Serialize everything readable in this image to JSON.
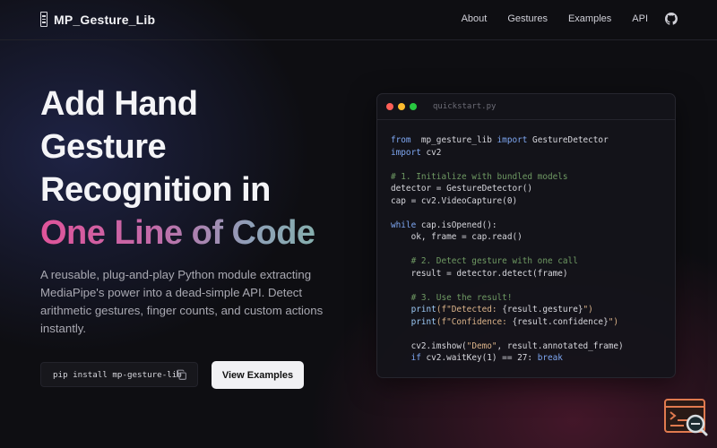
{
  "nav": {
    "brand": "MP_Gesture_Lib",
    "links": [
      "About",
      "Gestures",
      "Examples",
      "API"
    ],
    "github_icon": "github-icon"
  },
  "hero": {
    "title_lines": [
      "Add Hand",
      "Gesture",
      "Recognition in"
    ],
    "title_highlight": "One Line of Code",
    "description": "A reusable, plug-and-play Python module extracting MediaPipe's power into a dead-simple API. Detect arithmetic gestures, finger counts, and custom actions instantly.",
    "install_command": "pip install mp-gesture-lib",
    "copy_icon": "copy-icon",
    "cta_label": "View Examples"
  },
  "code_window": {
    "filename": "quickstart.py",
    "lines": [
      [
        [
          "kw",
          "from"
        ],
        [
          "",
          "  mp_gesture_lib "
        ],
        [
          "kw",
          "import"
        ],
        [
          "",
          " GestureDetector"
        ]
      ],
      [
        [
          "kw",
          "import"
        ],
        [
          "",
          " cv2"
        ]
      ],
      [
        [
          "",
          ""
        ]
      ],
      [
        [
          "cm",
          "# 1. Initialize with bundled models"
        ]
      ],
      [
        [
          "",
          "detector = GestureDetector()"
        ]
      ],
      [
        [
          "",
          "cap = cv2.VideoCapture(0)"
        ]
      ],
      [
        [
          "",
          ""
        ]
      ],
      [
        [
          "kw",
          "while"
        ],
        [
          "",
          " cap.isOpened():"
        ]
      ],
      [
        [
          "",
          "    ok, frame = cap.read()"
        ]
      ],
      [
        [
          "",
          ""
        ]
      ],
      [
        [
          "cm",
          "    # 2. Detect gesture with one call"
        ]
      ],
      [
        [
          "",
          "    result = detector.detect(frame)"
        ]
      ],
      [
        [
          "",
          ""
        ]
      ],
      [
        [
          "cm",
          "    # 3. Use the result!"
        ]
      ],
      [
        [
          "fx",
          "    print"
        ],
        [
          "st",
          "(f\"Detected: "
        ],
        [
          "",
          "{result.gesture}"
        ],
        [
          "st",
          "\")"
        ]
      ],
      [
        [
          "fx",
          "    print"
        ],
        [
          "st",
          "(f\"Confidence: "
        ],
        [
          "",
          "{result.confidence}"
        ],
        [
          "st",
          "\")"
        ]
      ],
      [
        [
          "",
          ""
        ]
      ],
      [
        [
          "",
          "    cv2.imshow("
        ],
        [
          "st",
          "\"Demo\""
        ],
        [
          "",
          ", result.annotated_frame)"
        ]
      ],
      [
        [
          "kw",
          "    if"
        ],
        [
          "",
          " cv2.waitKey(1) == 27: "
        ],
        [
          "kw",
          "break"
        ]
      ]
    ]
  },
  "colors": {
    "dot_red": "#ff5f57",
    "dot_yellow": "#febc2e",
    "dot_green": "#28c840",
    "gradient_start": "#e0549a",
    "gradient_end": "#7fb9a6"
  },
  "corner_badge_icon": "terminal-search-icon"
}
